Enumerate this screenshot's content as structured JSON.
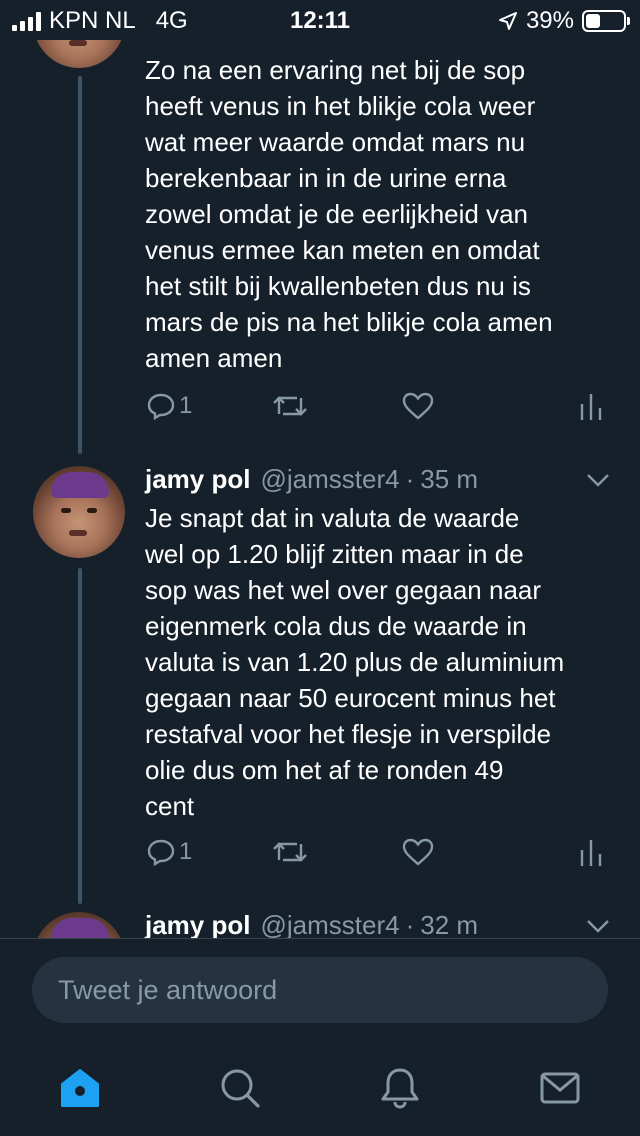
{
  "status_bar": {
    "carrier": "KPN NL",
    "network": "4G",
    "time": "12:11",
    "battery_percent_text": "39%",
    "battery_level": 0.39
  },
  "tweets": [
    {
      "body": "Zo na een ervaring net bij de sop\nheeft venus in het blikje cola weer\nwat meer waarde omdat mars nu\nberekenbaar in in de urine erna\nzowel omdat je de eerlijkheid van\nvenus ermee kan meten en omdat\nhet stilt bij kwallenbeten dus nu is\nmars de pis na het blikje cola amen\namen amen",
      "reply_count": "1"
    },
    {
      "name": "jamy pol",
      "handle": "@jamsster4",
      "separator": "·",
      "time": "35 m",
      "body": "Je snapt dat in valuta de waarde\nwel op 1.20 blijf zitten maar in de\nsop was het wel over gegaan naar\neigenmerk cola dus de waarde in\nvaluta is van 1.20 plus de aluminium\ngegaan naar 50 eurocent minus het\nrestafval voor het flesje in verspilde\nolie dus om het af te ronden 49\ncent",
      "reply_count": "1"
    },
    {
      "name": "jamy pol",
      "handle": "@jamsster4",
      "separator": "·",
      "time": "32 m"
    }
  ],
  "reply": {
    "placeholder": "Tweet je antwoord"
  },
  "tab_bar": {
    "items": [
      "home-icon",
      "search-icon",
      "notifications-icon",
      "messages-icon"
    ],
    "active": "home-icon",
    "accent": "#1da1f2"
  },
  "colors": {
    "background": "#15202b",
    "muted": "#8899a6",
    "accent": "#1da1f2"
  }
}
